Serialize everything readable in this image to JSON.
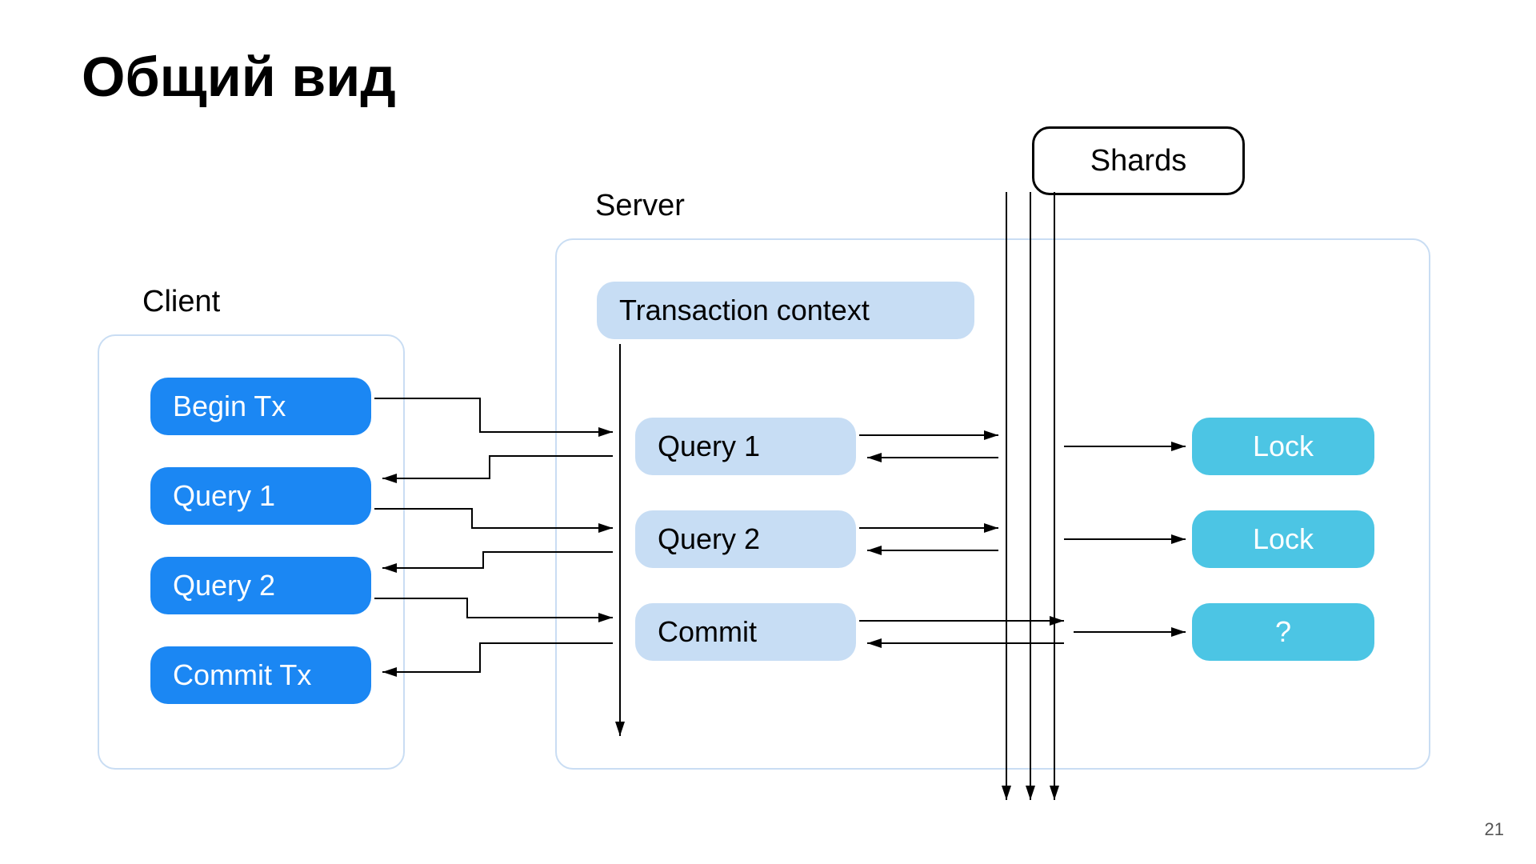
{
  "title": "Общий вид",
  "client": {
    "label": "Client",
    "begin": "Begin Tx",
    "q1": "Query 1",
    "q2": "Query 2",
    "commit": "Commit Tx"
  },
  "server": {
    "label": "Server",
    "context": "Transaction context",
    "q1": "Query 1",
    "q2": "Query 2",
    "commit": "Commit"
  },
  "shards": {
    "label": "Shards",
    "lock1": "Lock",
    "lock2": "Lock",
    "unknown": "?"
  },
  "page": "21"
}
